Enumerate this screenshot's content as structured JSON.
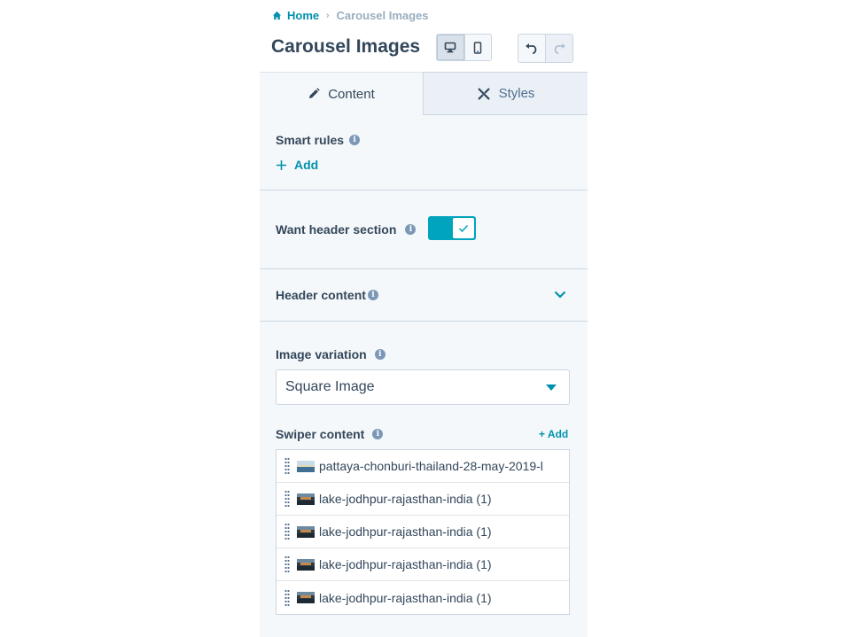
{
  "breadcrumb": {
    "home": "Home",
    "separator": "›",
    "current": "Carousel Images"
  },
  "title": "Carousel Images",
  "tabs": {
    "content": "Content",
    "styles": "Styles"
  },
  "smart_rules": {
    "label": "Smart rules",
    "add": "Add"
  },
  "header_section": {
    "label": "Want header section",
    "enabled": true
  },
  "header_content": {
    "label": "Header content"
  },
  "image_variation": {
    "label": "Image variation",
    "selected": "Square Image"
  },
  "swiper": {
    "label": "Swiper content",
    "add": "+ Add",
    "items": [
      {
        "name": "pattaya-chonburi-thailand-28-may-2019-l",
        "thumb": "beach"
      },
      {
        "name": "lake-jodhpur-rajasthan-india (1)",
        "thumb": "lake"
      },
      {
        "name": "lake-jodhpur-rajasthan-india (1)",
        "thumb": "lake"
      },
      {
        "name": "lake-jodhpur-rajasthan-india (1)",
        "thumb": "lake"
      },
      {
        "name": "lake-jodhpur-rajasthan-india (1)",
        "thumb": "lake"
      }
    ]
  },
  "colors": {
    "accent": "#0091ae",
    "toggle": "#00a4bd",
    "text": "#33475b",
    "panel": "#f5f8fa"
  }
}
